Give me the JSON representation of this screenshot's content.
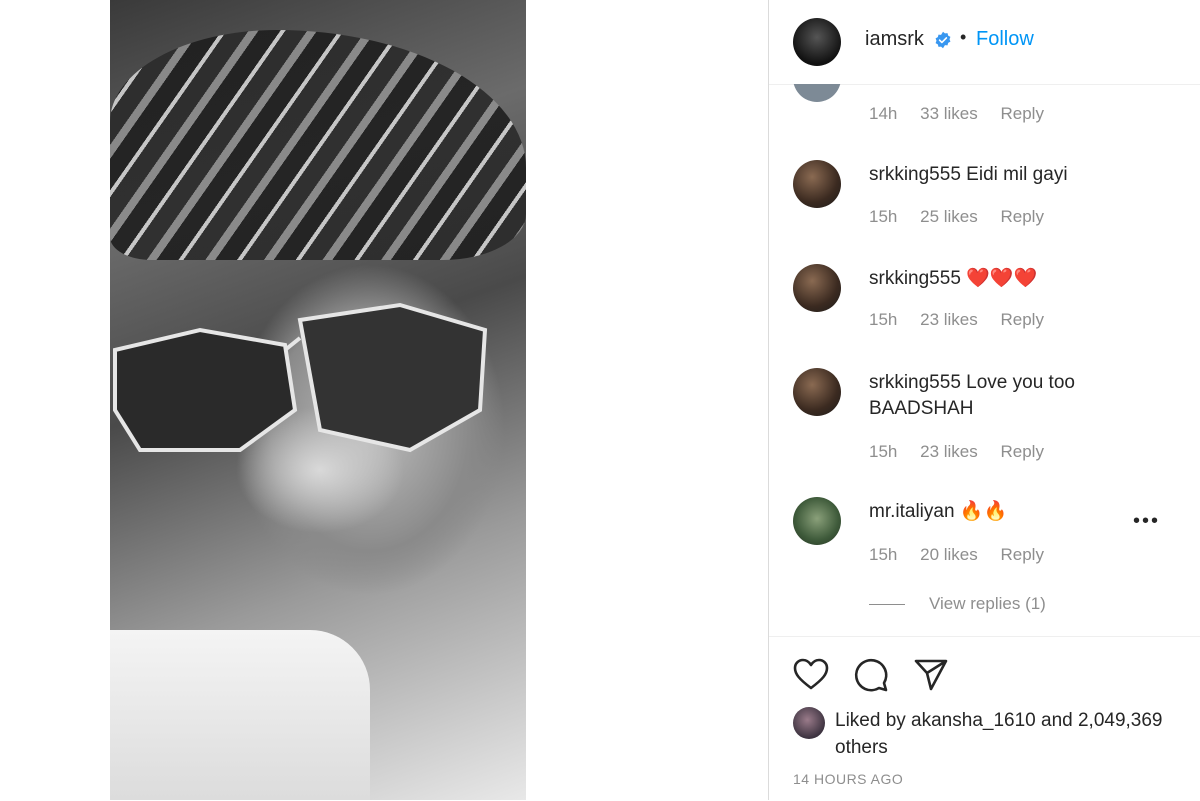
{
  "post": {
    "author": "iamsrk",
    "separator": "•",
    "follow_label": "Follow",
    "colors": {
      "accent": "#0095f6",
      "muted": "#8e8e8e",
      "heart": "#ed4956"
    }
  },
  "top_comment": {
    "time": "14h",
    "likes": "33 likes",
    "reply": "Reply"
  },
  "comments": [
    {
      "user": "srkking555",
      "text": " Eidi mil gayi",
      "time": "15h",
      "likes": "25 likes",
      "reply": "Reply"
    },
    {
      "user": "srkking555",
      "text": " ❤️❤️❤️",
      "time": "15h",
      "likes": "23 likes",
      "reply": "Reply"
    },
    {
      "user": "srkking555",
      "text": " Love you too BAADSHAH",
      "time": "15h",
      "likes": "23 likes",
      "reply": "Reply"
    },
    {
      "user": "mr.italiyan",
      "text": " 🔥🔥",
      "time": "15h",
      "likes": "20 likes",
      "reply": "Reply"
    }
  ],
  "more_label": "•••",
  "view_replies": "View replies (1)",
  "likes": {
    "prefix": "Liked by ",
    "user": "akansha_1610",
    "suffix": " and 2,049,369 others"
  },
  "timestamp": "14 HOURS AGO",
  "icons": {
    "like": "heart-icon",
    "comment": "comment-icon",
    "share": "share-icon",
    "verified": "verified-badge-icon",
    "more": "more-options-icon"
  }
}
